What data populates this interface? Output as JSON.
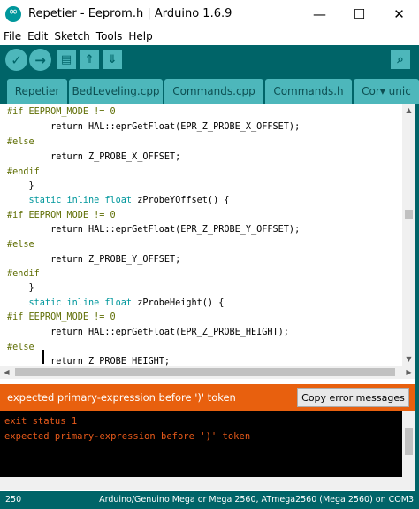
{
  "window": {
    "title": "Repetier - Eeprom.h | Arduino 1.6.9",
    "minimize_glyph": "—",
    "maximize_glyph": "☐",
    "close_glyph": "✕"
  },
  "menu": [
    "File",
    "Edit",
    "Sketch",
    "Tools",
    "Help"
  ],
  "toolbar": {
    "verify_icon": "✓",
    "upload_icon": "→",
    "new_icon": "▤",
    "open_icon": "⇑",
    "save_icon": "⇓",
    "serial_icon": "⌕"
  },
  "tabs": [
    "Repetier",
    "BedLeveling.cpp",
    "Commands.cpp",
    "Commands.h",
    "Cor▾ unic"
  ],
  "code_lines": [
    [
      {
        "t": "#if EEPROM_MODE != 0",
        "c": "dir"
      }
    ],
    [
      {
        "t": "        return HAL::eprGetFloat(EPR_Z_PROBE_X_OFFSET);",
        "c": "plain"
      }
    ],
    [
      {
        "t": "#else",
        "c": "dir"
      }
    ],
    [
      {
        "t": "        return Z_PROBE_X_OFFSET;",
        "c": "plain"
      }
    ],
    [
      {
        "t": "#endif",
        "c": "dir"
      }
    ],
    [
      {
        "t": "    }",
        "c": "plain"
      }
    ],
    [
      {
        "t": "    static inline float ",
        "c": "type"
      },
      {
        "t": "zProbeYOffset() {",
        "c": "plain"
      }
    ],
    [
      {
        "t": "#if EEPROM_MODE != 0",
        "c": "dir"
      }
    ],
    [
      {
        "t": "        return HAL::eprGetFloat(EPR_Z_PROBE_Y_OFFSET);",
        "c": "plain"
      }
    ],
    [
      {
        "t": "#else",
        "c": "dir"
      }
    ],
    [
      {
        "t": "        return Z_PROBE_Y_OFFSET;",
        "c": "plain"
      }
    ],
    [
      {
        "t": "#endif",
        "c": "dir"
      }
    ],
    [
      {
        "t": "    }",
        "c": "plain"
      }
    ],
    [
      {
        "t": "    static inline float ",
        "c": "type"
      },
      {
        "t": "zProbeHeight() {",
        "c": "plain"
      }
    ],
    [
      {
        "t": "#if EEPROM_MODE != 0",
        "c": "dir"
      }
    ],
    [
      {
        "t": "        return HAL::eprGetFloat(EPR_Z_PROBE_HEIGHT);",
        "c": "plain"
      }
    ],
    [
      {
        "t": "#else",
        "c": "dir"
      }
    ],
    [
      {
        "t": "        return Z_PROBE_HEIGHT;",
        "c": "plain"
      }
    ]
  ],
  "error_bar": {
    "message": "expected primary-expression before ')' token",
    "copy_button": "Copy error messages"
  },
  "console": [
    "exit status 1",
    "expected primary-expression before ')' token"
  ],
  "status": {
    "line_number": "250",
    "board": "Arduino/Genuino Mega or Mega 2560, ATmega2560 (Mega 2560) on COM3"
  },
  "colors": {
    "teal_dark": "#006468",
    "teal_light": "#4db7bb",
    "error_orange": "#e8600e",
    "console_text": "#e85a1a"
  }
}
